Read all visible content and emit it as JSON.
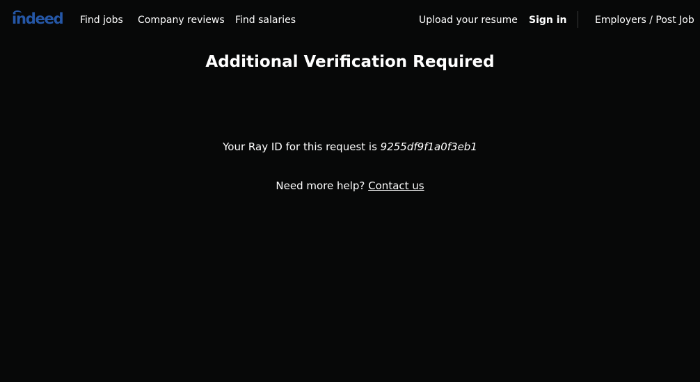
{
  "header": {
    "logo_text": "indeed",
    "logo_color": "#2557a7",
    "nav_left": [
      "Find jobs",
      "Company reviews",
      "Find salaries"
    ],
    "upload_resume": "Upload your resume",
    "sign_in": "Sign in",
    "employers": "Employers / Post Job"
  },
  "main": {
    "title": "Additional Verification Required",
    "ray_prefix": "Your Ray ID for this request is",
    "ray_id": "9255df9f1a0f3eb1",
    "help_prefix": "Need more help?",
    "contact_link": "Contact us"
  },
  "colors": {
    "background": "#070808",
    "text": "#ffffff"
  }
}
